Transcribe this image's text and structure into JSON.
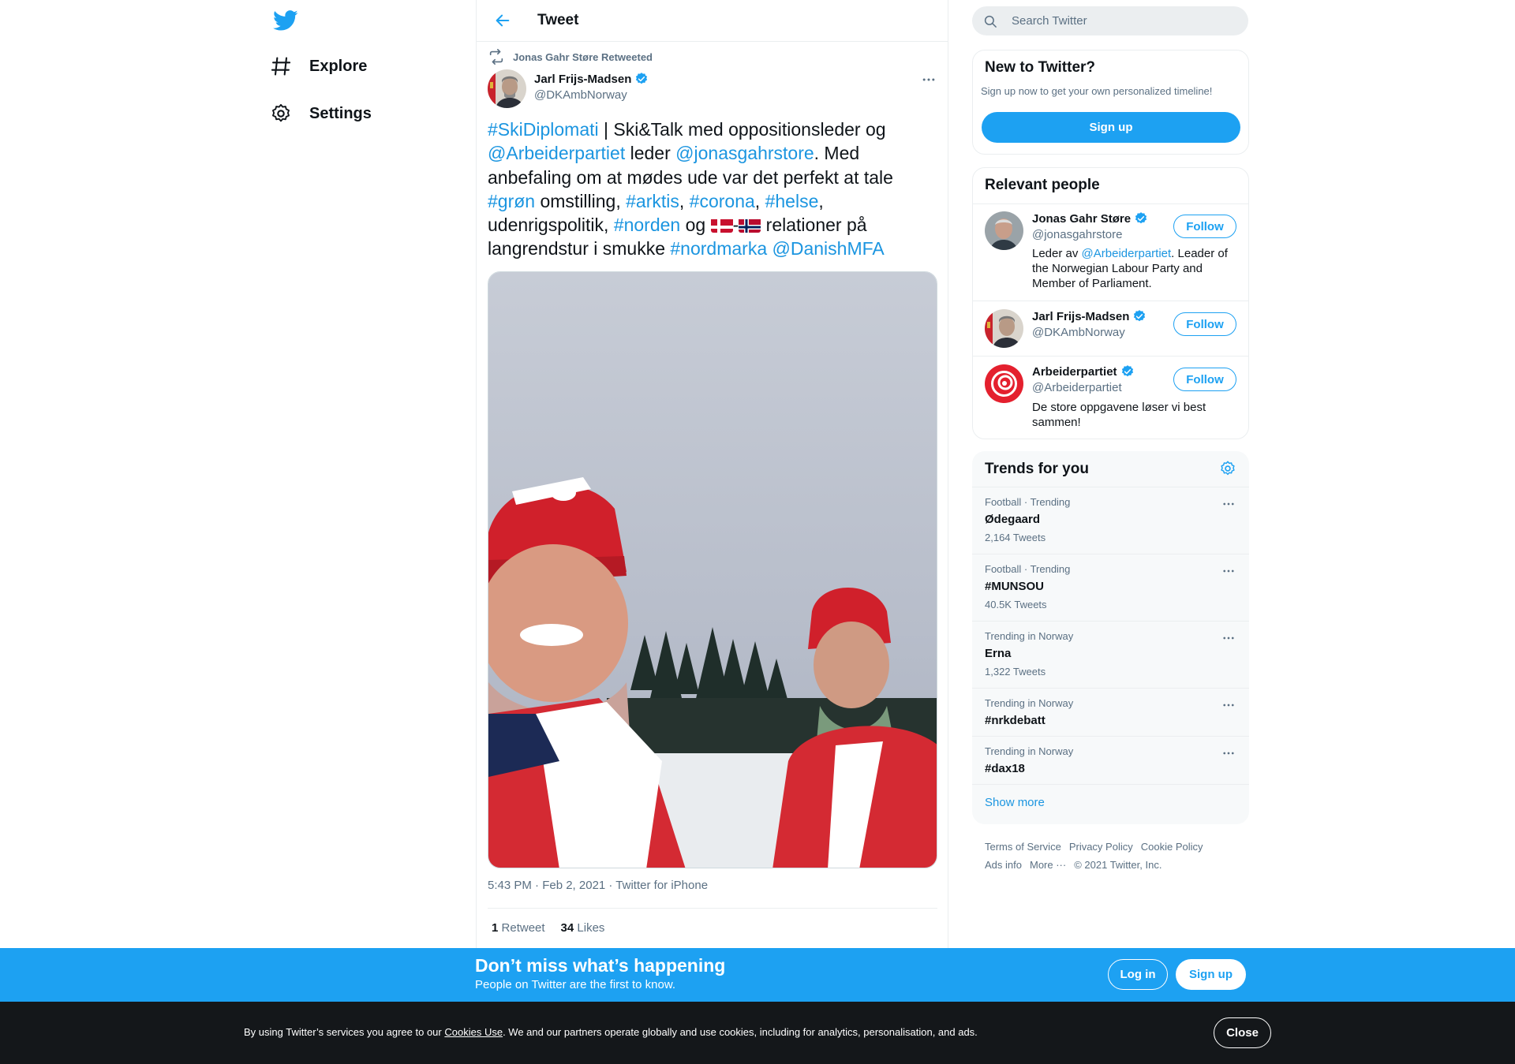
{
  "nav": {
    "explore_label": "Explore",
    "settings_label": "Settings"
  },
  "header": {
    "title": "Tweet"
  },
  "tweet": {
    "retweeted_by": "Jonas Gahr Støre Retweeted",
    "author_name": "Jarl Frijs-Madsen",
    "author_handle": "@DKAmbNorway",
    "text": {
      "t1": "#SkiDiplomati",
      "t2": " | Ski&Talk med oppositionsleder og ",
      "t3": "@Arbeiderpartiet",
      "t4": " leder ",
      "t5": "@jonasgahrstore",
      "t6": ". Med anbefaling om at mødes ude var det perfekt at tale ",
      "t7": "#grøn",
      "t8": " omstilling, ",
      "t9": "#arktis",
      "t10": ", ",
      "t11": "#corona",
      "t12": ", ",
      "t13": "#helse",
      "t14": ", udenrigspolitik, ",
      "t15": "#norden",
      "t16": " og ",
      "t17": "-",
      "t18": " relationer på langrendstur i smukke ",
      "t19": "#nordmarka",
      "t20": " ",
      "t21": "@DanishMFA"
    },
    "meta": "5:43 PM · Feb 2, 2021 · Twitter for iPhone",
    "retweets_count": "1",
    "retweets_label": "Retweet",
    "likes_count": "34",
    "likes_label": "Likes"
  },
  "search": {
    "placeholder": "Search Twitter"
  },
  "new_to_twitter": {
    "title": "New to Twitter?",
    "subtitle": "Sign up now to get your own personalized timeline!",
    "signup_label": "Sign up"
  },
  "relevant_people": {
    "title": "Relevant people",
    "people": [
      {
        "name": "Jonas Gahr Støre",
        "handle": "@jonasgahrstore",
        "bio_pre": "Leder av ",
        "bio_link": "@Arbeiderpartiet",
        "bio_post": ". Leader of the Norwegian Labour Party and Member of Parliament.",
        "follow_label": "Follow"
      },
      {
        "name": "Jarl Frijs-Madsen",
        "handle": "@DKAmbNorway",
        "follow_label": "Follow"
      },
      {
        "name": "Arbeiderpartiet",
        "handle": "@Arbeiderpartiet",
        "bio": "De store oppgavene løser vi best sammen!",
        "follow_label": "Follow"
      }
    ]
  },
  "trends": {
    "title": "Trends for you",
    "items": [
      {
        "context": "Football · Trending",
        "name": "Ødegaard",
        "count": "2,164 Tweets"
      },
      {
        "context": "Football · Trending",
        "name": "#MUNSOU",
        "count": "40.5K Tweets"
      },
      {
        "context": "Trending in Norway",
        "name": "Erna",
        "count": "1,322 Tweets"
      },
      {
        "context": "Trending in Norway",
        "name": "#nrkdebatt"
      },
      {
        "context": "Trending in Norway",
        "name": "#dax18"
      }
    ],
    "show_more": "Show more"
  },
  "footer": {
    "terms": "Terms of Service",
    "privacy": "Privacy Policy",
    "cookie": "Cookie Policy",
    "ads": "Ads info",
    "more": "More ···",
    "copyright": "© 2021 Twitter, Inc."
  },
  "banner": {
    "title": "Don’t miss what’s happening",
    "subtitle": "People on Twitter are the first to know.",
    "login_label": "Log in",
    "signup_label": "Sign up"
  },
  "cookie": {
    "text_pre": "By using Twitter’s services you agree to our ",
    "link": "Cookies Use",
    "text_post": ". We and our partners operate globally and use cookies, including for analytics, personalisation, and ads.",
    "close_label": "Close"
  },
  "colors": {
    "accent": "#1da1f2",
    "link": "#1b95e0",
    "muted": "#5b7083",
    "cookie_bg": "#14171a"
  }
}
